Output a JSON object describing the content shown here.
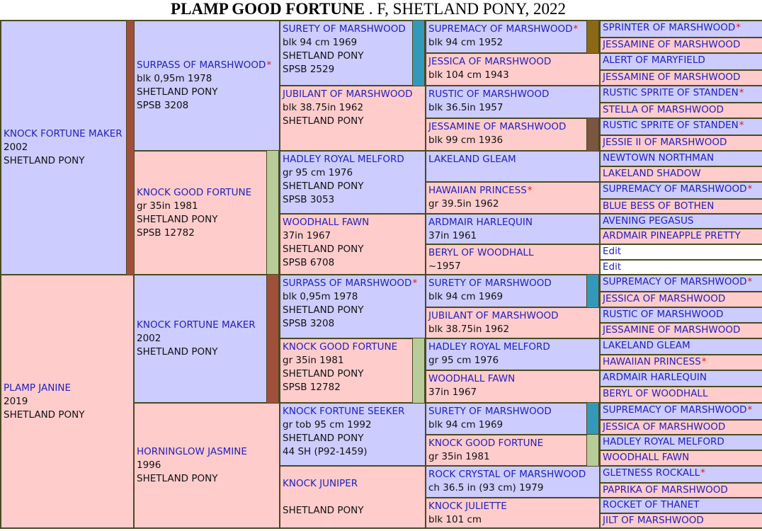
{
  "title": {
    "name": "PLAMP GOOD FORTUNE",
    "rest": " . F, SHETLAND PONY, 2022"
  },
  "colors": {
    "male": "#ccccff",
    "female": "#ffcccc",
    "link": "#2222bb",
    "star": "#ee1111",
    "bar_chestnut": "#a0503a",
    "bar_sage": "#b8cc99",
    "bar_blue": "#3399bb",
    "bar_brown": "#8b6914",
    "bar_darkbrown": "#7a5540"
  },
  "g1": [
    {
      "name": "KNOCK FORTUNE MAKER",
      "lines": [
        "2002",
        "SHETLAND PONY"
      ]
    },
    {
      "name": "PLAMP JANINE",
      "lines": [
        "2019",
        "SHETLAND PONY"
      ]
    }
  ],
  "g2": [
    {
      "name": "SURPASS OF MARSHWOOD",
      "star": "*",
      "lines": [
        "blk 0,95m 1978",
        "SHETLAND PONY",
        "SPSB 3208"
      ]
    },
    {
      "name": "KNOCK GOOD FORTUNE",
      "lines": [
        "gr 35in 1981",
        "SHETLAND PONY",
        "SPSB 12782"
      ]
    },
    {
      "name": "KNOCK FORTUNE MAKER",
      "lines": [
        "2002",
        "SHETLAND PONY"
      ]
    },
    {
      "name": "HORNINGLOW JASMINE",
      "lines": [
        "1996",
        "SHETLAND PONY"
      ]
    }
  ],
  "g3": [
    {
      "name": "SURETY OF MARSHWOOD",
      "lines": [
        "blk 94 cm 1969",
        "SHETLAND PONY",
        "SPSB 2529"
      ]
    },
    {
      "name": "JUBILANT OF MARSHWOOD",
      "lines": [
        "blk 38.75in 1962",
        "SHETLAND PONY"
      ]
    },
    {
      "name": "HADLEY ROYAL MELFORD",
      "lines": [
        "gr 95 cm 1976",
        "SHETLAND PONY",
        "SPSB 3053"
      ]
    },
    {
      "name": "WOODHALL FAWN",
      "lines": [
        "37in 1967",
        "SHETLAND PONY",
        "SPSB 6708"
      ]
    },
    {
      "name": "SURPASS OF MARSHWOOD",
      "star": "*",
      "lines": [
        "blk 0,95m 1978",
        "SHETLAND PONY",
        "SPSB 3208"
      ]
    },
    {
      "name": "KNOCK GOOD FORTUNE",
      "lines": [
        "gr 35in 1981",
        "SHETLAND PONY",
        "SPSB 12782"
      ]
    },
    {
      "name": "KNOCK FORTUNE SEEKER",
      "lines": [
        "gr tob 95 cm 1992",
        "SHETLAND PONY",
        "44 SH (P92-1459)"
      ]
    },
    {
      "name": "KNOCK JUNIPER",
      "lines": [
        "",
        "SHETLAND PONY"
      ]
    }
  ],
  "g4": [
    {
      "name": "SUPREMACY OF MARSHWOOD",
      "star": "*",
      "lines": [
        "blk 94 cm 1952"
      ]
    },
    {
      "name": "JESSICA OF MARSHWOOD",
      "lines": [
        "blk 104 cm 1943"
      ]
    },
    {
      "name": "RUSTIC OF MARSHWOOD",
      "lines": [
        "blk 36.5in 1957"
      ]
    },
    {
      "name": "JESSAMINE OF MARSHWOOD",
      "lines": [
        "blk 99 cm 1936"
      ]
    },
    {
      "name": "LAKELAND GLEAM",
      "lines": []
    },
    {
      "name": "HAWAIIAN PRINCESS",
      "star": "*",
      "lines": [
        "gr 39.5in 1962"
      ]
    },
    {
      "name": "ARDMAIR HARLEQUIN",
      "lines": [
        "37in 1961"
      ]
    },
    {
      "name": "BERYL OF WOODHALL",
      "lines": [
        "~1957"
      ]
    },
    {
      "name": "SURETY OF MARSHWOOD",
      "lines": [
        "blk 94 cm 1969"
      ]
    },
    {
      "name": "JUBILANT OF MARSHWOOD",
      "lines": [
        "blk 38.75in 1962"
      ]
    },
    {
      "name": "HADLEY ROYAL MELFORD",
      "lines": [
        "gr 95 cm 1976"
      ]
    },
    {
      "name": "WOODHALL FAWN",
      "lines": [
        "37in 1967"
      ]
    },
    {
      "name": "SURETY OF MARSHWOOD",
      "lines": [
        "blk 94 cm 1969"
      ]
    },
    {
      "name": "KNOCK GOOD FORTUNE",
      "lines": [
        "gr 35in 1981"
      ]
    },
    {
      "name": "ROCK CRYSTAL OF MARSHWOOD",
      "lines": [
        "ch 36.5 in (93 cm) 1979"
      ]
    },
    {
      "name": "KNOCK JULIETTE",
      "lines": [
        "blk 101 cm"
      ]
    }
  ],
  "g5": [
    {
      "name": "SPRINTER OF MARSHWOOD",
      "star": "*"
    },
    {
      "name": "JESSAMINE OF MARSHWOOD"
    },
    {
      "name": "ALERT OF MARYFIELD"
    },
    {
      "name": "JESSAMINE OF MARSHWOOD"
    },
    {
      "name": "RUSTIC SPRITE OF STANDEN",
      "star": "*"
    },
    {
      "name": "STELLA OF MARSHWOOD"
    },
    {
      "name": "RUSTIC SPRITE OF STANDEN",
      "star": "*"
    },
    {
      "name": "JESSIE II OF MARSHWOOD"
    },
    {
      "name": "NEWTOWN NORTHMAN"
    },
    {
      "name": "LAKELAND SHADOW"
    },
    {
      "name": "SUPREMACY OF MARSHWOOD",
      "star": "*"
    },
    {
      "name": "BLUE BESS OF BOTHEN"
    },
    {
      "name": "AVENING PEGASUS"
    },
    {
      "name": "ARDMAIR PINEAPPLE PRETTY"
    },
    {
      "name": "Edit"
    },
    {
      "name": "Edit"
    },
    {
      "name": "SUPREMACY OF MARSHWOOD",
      "star": "*"
    },
    {
      "name": "JESSICA OF MARSHWOOD"
    },
    {
      "name": "RUSTIC OF MARSHWOOD"
    },
    {
      "name": "JESSAMINE OF MARSHWOOD"
    },
    {
      "name": "LAKELAND GLEAM"
    },
    {
      "name": "HAWAIIAN PRINCESS",
      "star": "*"
    },
    {
      "name": "ARDMAIR HARLEQUIN"
    },
    {
      "name": "BERYL OF WOODHALL"
    },
    {
      "name": "SUPREMACY OF MARSHWOOD",
      "star": "*"
    },
    {
      "name": "JESSICA OF MARSHWOOD"
    },
    {
      "name": "HADLEY ROYAL MELFORD"
    },
    {
      "name": "WOODHALL FAWN"
    },
    {
      "name": "GLETNESS ROCKALL",
      "star": "*"
    },
    {
      "name": "PAPRIKA OF MARSHWOOD"
    },
    {
      "name": "ROCKET OF THANET"
    },
    {
      "name": "JILT OF MARSHWOOD"
    }
  ]
}
